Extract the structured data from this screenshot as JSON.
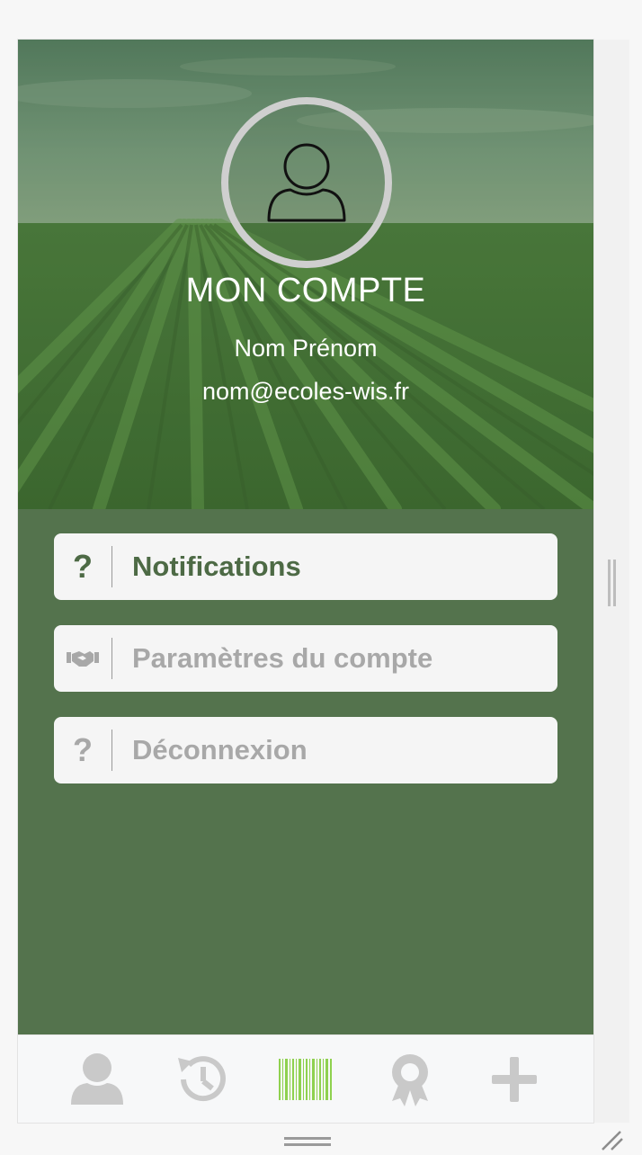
{
  "header": {
    "title": "MON COMPTE",
    "user_name": "Nom Prénom",
    "user_email": "nom@ecoles-wis.fr",
    "avatar_icon": "user-outline-icon"
  },
  "menu": [
    {
      "label": "Notifications",
      "icon": "question-mark-icon",
      "icon_glyph": "?",
      "state": "active"
    },
    {
      "label": "Paramètres du compte",
      "icon": "handshake-icon",
      "state": "inactive"
    },
    {
      "label": "Déconnexion",
      "icon": "question-mark-icon",
      "icon_glyph": "?",
      "state": "inactive"
    }
  ],
  "tabbar": [
    {
      "name": "account",
      "icon": "user-icon"
    },
    {
      "name": "history",
      "icon": "history-icon"
    },
    {
      "name": "scan",
      "icon": "barcode-icon"
    },
    {
      "name": "rewards",
      "icon": "award-icon"
    },
    {
      "name": "add",
      "icon": "plus-icon"
    }
  ],
  "colors": {
    "primary_green": "#54734d",
    "active_text": "#4d6a45",
    "inactive_text": "#a8a8a8",
    "barcode_green": "#8fd14f",
    "tab_icon_gray": "#c9c9c9"
  }
}
